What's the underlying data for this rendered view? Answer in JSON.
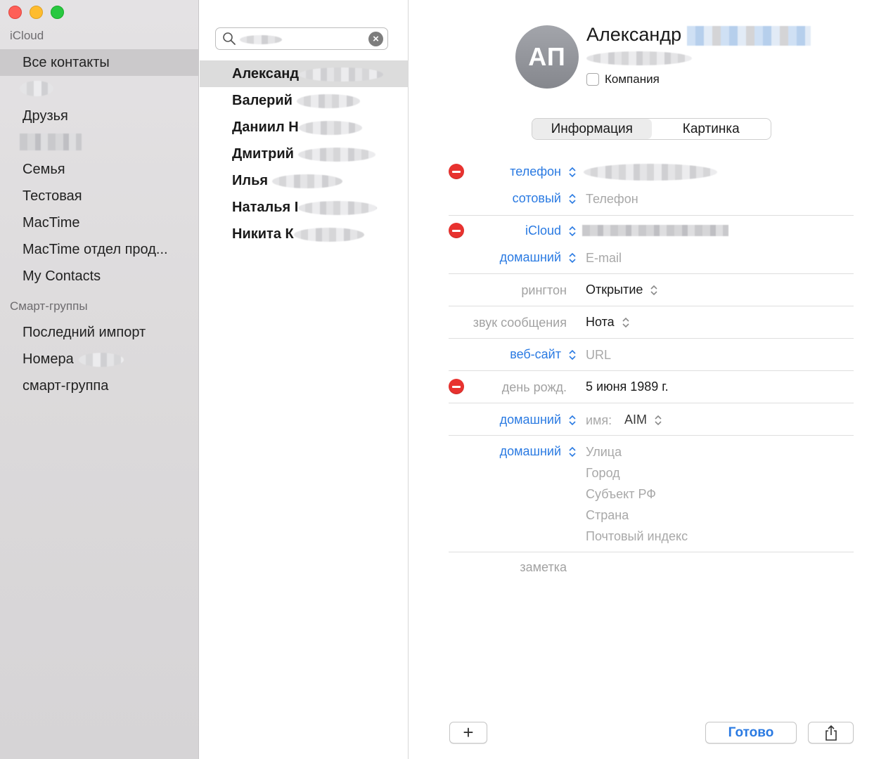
{
  "window": {
    "controls": [
      "close",
      "minimize",
      "zoom"
    ]
  },
  "sidebar": {
    "section_icloud": "iCloud",
    "items": [
      {
        "label": "Все контакты",
        "selected": true
      },
      {
        "label": "",
        "redacted": true
      },
      {
        "label": "Друзья"
      },
      {
        "label": "",
        "redacted": true
      },
      {
        "label": "Семья"
      },
      {
        "label": "Тестовая"
      },
      {
        "label": "MacTime"
      },
      {
        "label": "MacTime отдел прод..."
      },
      {
        "label": "My Contacts"
      }
    ],
    "section_smart": "Смарт-группы",
    "smart_items": [
      {
        "label": "Последний импорт"
      },
      {
        "label": "Номера"
      },
      {
        "label": "смарт-группа"
      }
    ]
  },
  "search": {
    "value": "",
    "clear_icon": "clear-icon"
  },
  "contacts": [
    {
      "first": "Александ",
      "selected": true
    },
    {
      "first": "Валерий"
    },
    {
      "first": "Даниил Н"
    },
    {
      "first": "Дмитрий"
    },
    {
      "first": "Илья"
    },
    {
      "first": "Наталья I"
    },
    {
      "first": "Никита К"
    }
  ],
  "detail": {
    "initials": "АП",
    "first_name": "Александр",
    "company_label": "Компания",
    "tabs": [
      {
        "label": "Информация",
        "active": true
      },
      {
        "label": "Картинка"
      }
    ],
    "phone_label": "телефон",
    "mobile_label": "сотовый",
    "mobile_placeholder": "Телефон",
    "icloud_label": "iCloud",
    "home_email_label": "домашний",
    "email_placeholder": "E-mail",
    "ringtone_label": "рингтон",
    "ringtone_value": "Открытие",
    "message_sound_label": "звук сообщения",
    "message_sound_value": "Нота",
    "website_label": "веб-сайт",
    "url_placeholder": "URL",
    "birthday_label": "день рожд.",
    "birthday_value": "5 июня 1989 г.",
    "im_label": "домашний",
    "im_name_label": "имя:",
    "im_service": "AIM",
    "address_label": "домашний",
    "address_placeholders": {
      "street": "Улица",
      "city": "Город",
      "state": "Субъект РФ",
      "country": "Страна",
      "zip": "Почтовый индекс"
    },
    "note_label": "заметка"
  },
  "footer": {
    "add_label": "+",
    "done_label": "Готово",
    "share_icon": "share-icon"
  },
  "colors": {
    "accent": "#2a7ae2",
    "delete": "#e8322f",
    "sidebar_bg": "#dcdadb",
    "selection": "#cbc9cb"
  }
}
